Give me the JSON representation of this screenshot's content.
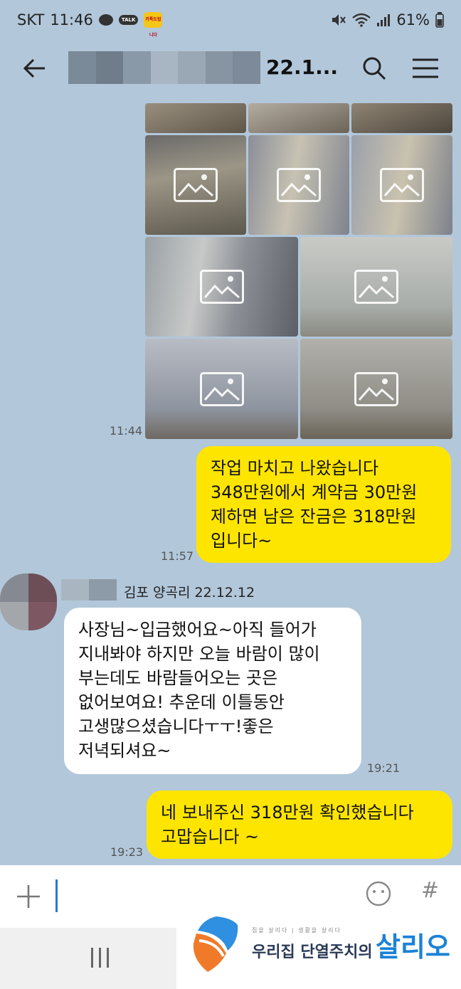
{
  "status_bar": {
    "carrier": "SKT",
    "time": "11:46",
    "battery": "61%",
    "app_badge_text": "카톡도됩니다"
  },
  "header": {
    "title": "22.1..."
  },
  "photo_message": {
    "time": "11:44",
    "photo_count_visible": 9
  },
  "messages": [
    {
      "id": "m1",
      "sender": "me",
      "time": "11:57",
      "lines": [
        "작업 마치고 나왔습니다",
        "348만원에서 계약금 30만원",
        "제하면 남은 잔금은 318만원",
        "입니다~"
      ]
    },
    {
      "id": "m2",
      "sender": "other",
      "sender_name": "김포 양곡리 22.12.12",
      "time": "19:21",
      "lines": [
        "사장님~입금했어요~아직 들어가",
        "지내봐야 하지만 오늘 바람이 많이",
        "부는데도 바람들어오는 곳은",
        "없어보여요! 추운데 이틀동안",
        "고생많으셨습니다ㅜㅜ!좋은",
        "저녁되셔요~"
      ]
    },
    {
      "id": "m3",
      "sender": "me",
      "time": "19:23",
      "lines": [
        "네 보내주신 318만원 확인했습니다",
        "고맙습니다 ~"
      ]
    }
  ],
  "input": {
    "hash_label": "#"
  },
  "watermark": {
    "tagline": "집을 살리다 | 생활을 살리다",
    "subtitle": "우리집 단열주치의",
    "brand": "살리오"
  },
  "colors": {
    "chat_background": "#b2c7da",
    "my_bubble": "#fee500",
    "other_bubble": "#ffffff",
    "cursor": "#2a76e0",
    "brand_blue": "#1b82d6"
  }
}
